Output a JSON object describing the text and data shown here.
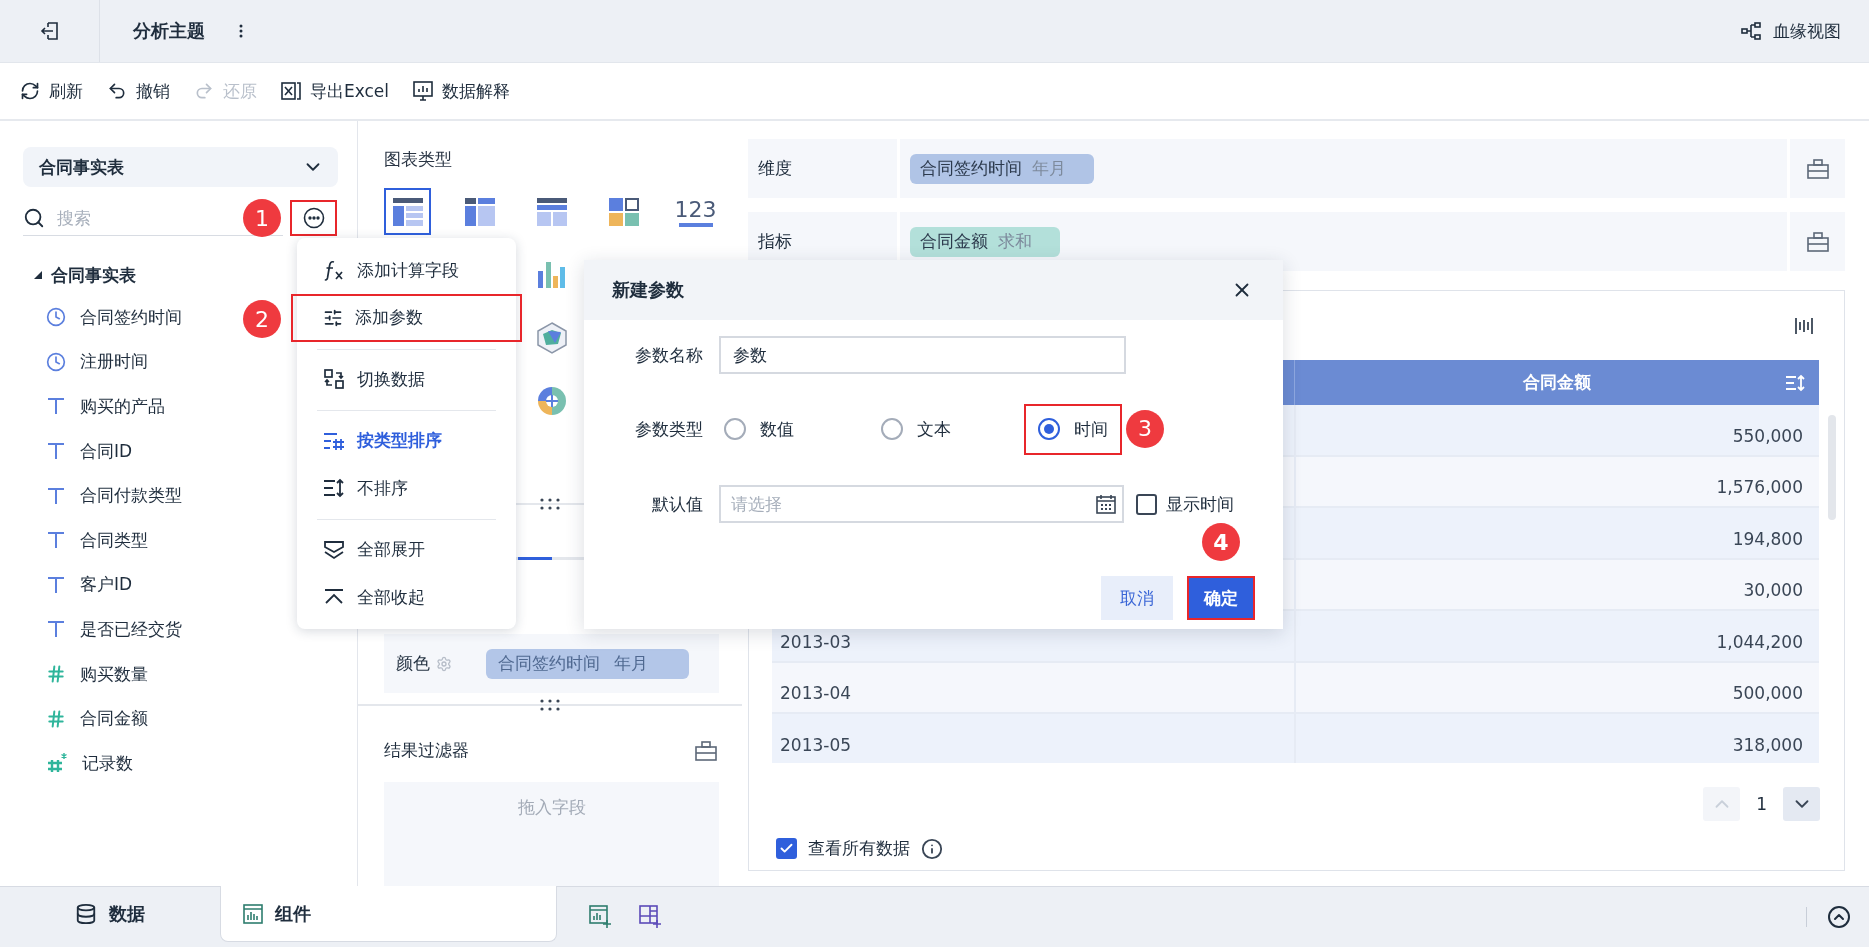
{
  "top_bar": {
    "title": "分析主题",
    "lineage_link": "血缘视图"
  },
  "toolbar": [
    {
      "label": "刷新",
      "kind": "refresh",
      "disabled": false
    },
    {
      "label": "撤销",
      "kind": "undo",
      "disabled": false
    },
    {
      "label": "还原",
      "kind": "redo",
      "disabled": true
    },
    {
      "label": "导出Excel",
      "kind": "export",
      "disabled": false
    },
    {
      "label": "数据解释",
      "kind": "explain",
      "disabled": false
    }
  ],
  "data_panel": {
    "dataset": "合同事实表",
    "search": {
      "placeholder": "搜索"
    },
    "more_button": {
      "highlighted": true,
      "badge": "1"
    },
    "tree": {
      "label": "合同事实表",
      "expanded": true,
      "children": [
        {
          "label": "合同签约时间",
          "kind": "date"
        },
        {
          "label": "注册时间",
          "kind": "date"
        },
        {
          "label": "购买的产品",
          "kind": "text"
        },
        {
          "label": "合同ID",
          "kind": "text"
        },
        {
          "label": "合同付款类型",
          "kind": "text"
        },
        {
          "label": "合同类型",
          "kind": "text"
        },
        {
          "label": "客户ID",
          "kind": "text"
        },
        {
          "label": "是否已经交货",
          "kind": "text"
        },
        {
          "label": "购买数量",
          "kind": "number"
        },
        {
          "label": "合同金额",
          "kind": "number"
        },
        {
          "label": "记录数",
          "kind": "count"
        }
      ]
    }
  },
  "field_menu": {
    "groups": [
      [
        {
          "label": "添加计算字段",
          "kind": "formula",
          "selected": false,
          "highlighted": false
        },
        {
          "label": "添加参数",
          "kind": "parameter",
          "selected": false,
          "highlighted": true,
          "badge": "2"
        }
      ],
      [
        {
          "label": "切换数据",
          "kind": "switch",
          "selected": false,
          "highlighted": false
        }
      ],
      [
        {
          "label": "按类型排序",
          "kind": "sort-type",
          "selected": true,
          "highlighted": false
        },
        {
          "label": "不排序",
          "kind": "no-sort",
          "selected": false,
          "highlighted": false
        }
      ],
      [
        {
          "label": "全部展开",
          "kind": "expand",
          "selected": false,
          "highlighted": false
        },
        {
          "label": "全部收起",
          "kind": "collapse",
          "selected": false,
          "highlighted": false
        }
      ]
    ]
  },
  "chart_panel": {
    "title": "图表类型",
    "chart_types": [
      {
        "kind": "grouped-table",
        "selected": true
      },
      {
        "kind": "cross-table",
        "selected": false
      },
      {
        "kind": "detail-table",
        "selected": false
      },
      {
        "kind": "tiles",
        "selected": false
      },
      {
        "kind": "number",
        "label": "123",
        "selected": false
      },
      {
        "kind": "bar",
        "selected": false
      },
      {
        "kind": "radar",
        "selected": false
      },
      {
        "kind": "pie",
        "selected": false
      }
    ],
    "color_row": {
      "label": "颜色",
      "field": "合同签约时间",
      "aggregation": "年月"
    },
    "result_filter": {
      "title": "结果过滤器",
      "placeholder": "拖入字段"
    }
  },
  "shelves": [
    {
      "label": "维度",
      "kind": "dimension",
      "field": "合同签约时间",
      "aggregation": "年月"
    },
    {
      "label": "指标",
      "kind": "measure",
      "field": "合同金额",
      "aggregation": "求和"
    }
  ],
  "table": {
    "header": {
      "column_2": "合同金额"
    },
    "rows": [
      {
        "column_2": "550,000"
      },
      {
        "column_2": "1,576,000"
      },
      {
        "column_2": "194,800"
      },
      {
        "column_2": "30,000"
      },
      {
        "column_1": "2013-03",
        "column_2": "1,044,200"
      },
      {
        "column_1": "2013-04",
        "column_2": "500,000"
      },
      {
        "column_1": "2013-05",
        "column_2": "318,000"
      }
    ]
  },
  "pagination": {
    "page": "1",
    "prev_disabled": true,
    "next_disabled": false
  },
  "show_all_data": {
    "label": "查看所有数据",
    "checked": true
  },
  "dialog": {
    "title": "新建参数",
    "name": {
      "label": "参数名称",
      "value": "参数"
    },
    "type": {
      "label": "参数类型",
      "options": [
        {
          "label": "数值",
          "selected": false,
          "highlighted": false
        },
        {
          "label": "文本",
          "selected": false,
          "highlighted": false
        },
        {
          "label": "时间",
          "selected": true,
          "highlighted": true,
          "badge": "3"
        }
      ]
    },
    "default": {
      "label": "默认值",
      "placeholder": "请选择",
      "show_time": {
        "label": "显示时间",
        "checked": false
      }
    },
    "buttons": [
      {
        "label": "取消",
        "kind": "secondary",
        "highlighted": false
      },
      {
        "label": "确定",
        "kind": "primary",
        "highlighted": true,
        "badge": "4"
      }
    ]
  },
  "bottom_tabs": [
    {
      "label": "数据",
      "kind": "data",
      "selected": false
    },
    {
      "label": "组件",
      "kind": "component",
      "selected": true
    }
  ]
}
